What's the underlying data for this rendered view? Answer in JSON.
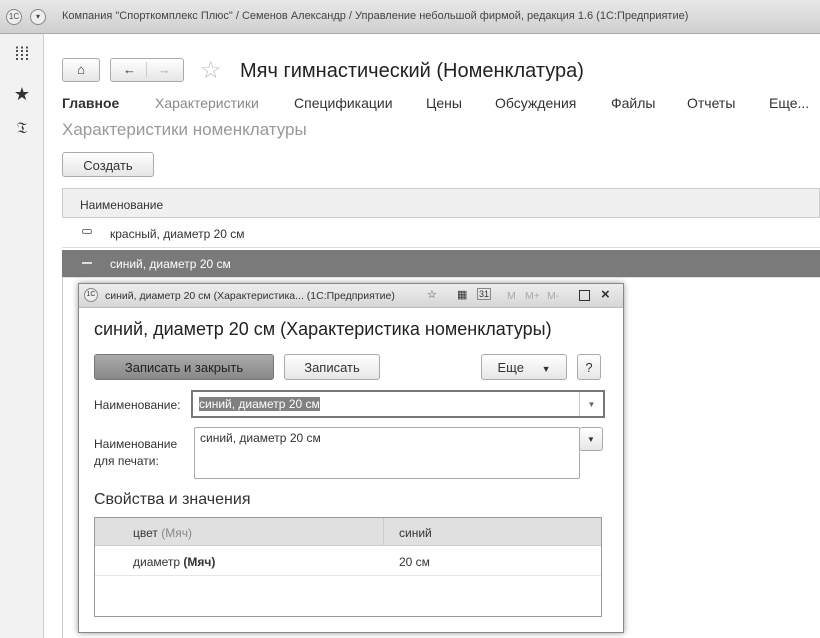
{
  "window": {
    "title": "Компания \"Спорткомплекс Плюс\" / Семенов Александр / Управление небольшой фирмой, редакция 1.6  (1С:Предприятие)"
  },
  "page": {
    "title": "Мяч гимнастический (Номенклатура)",
    "section": "Характеристики номенклатуры",
    "create_label": "Создать"
  },
  "tabs": [
    {
      "label": "Главное"
    },
    {
      "label": "Характеристики"
    },
    {
      "label": "Спецификации"
    },
    {
      "label": "Цены"
    },
    {
      "label": "Обсуждения"
    },
    {
      "label": "Файлы"
    },
    {
      "label": "Отчеты"
    },
    {
      "label": "Еще..."
    }
  ],
  "list": {
    "header": "Наименование",
    "rows": [
      {
        "name": "красный, диаметр 20 см"
      },
      {
        "name": "синий, диаметр 20 см"
      }
    ]
  },
  "dialog": {
    "window_title": "синий, диаметр 20 см (Характеристика...  (1С:Предприятие)",
    "mem": [
      "M",
      "M+",
      "M-"
    ],
    "title": "синий, диаметр 20 см (Характеристика номенклатуры)",
    "save_close": "Записать и закрыть",
    "save": "Записать",
    "more": "Еще",
    "help": "?",
    "name_label": "Наименование:",
    "name_value": "синий, диаметр 20 см",
    "print_label_1": "Наименование",
    "print_label_2": "для печати:",
    "print_value": "синий, диаметр 20 см",
    "props_title": "Свойства и значения",
    "props": [
      {
        "prop": "цвет",
        "owner": "(Мяч)",
        "value": "синий"
      },
      {
        "prop": "диаметр",
        "owner": "(Мяч)",
        "value": "20 см"
      }
    ]
  }
}
